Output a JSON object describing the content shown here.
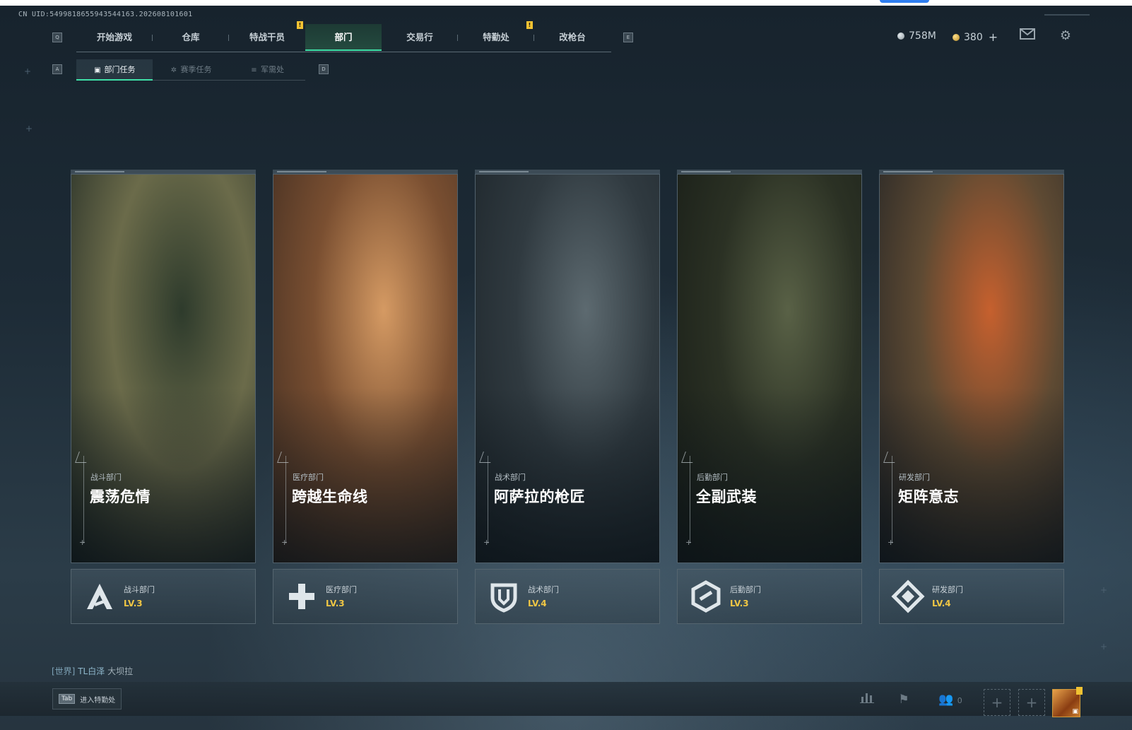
{
  "uid": "CN UID:5499818655943544163.202608101601",
  "keys": {
    "prev_tab": "Q",
    "next_tab": "E",
    "prev_sub": "A",
    "next_sub": "D"
  },
  "main_nav": {
    "tabs": [
      {
        "label": "开始游戏",
        "active": false
      },
      {
        "label": "仓库",
        "active": false
      },
      {
        "label": "特战干员",
        "active": false
      },
      {
        "label": "部门",
        "active": true
      },
      {
        "label": "交易行",
        "active": false
      },
      {
        "label": "特勤处",
        "active": false
      },
      {
        "label": "改枪台",
        "active": false
      }
    ]
  },
  "sub_nav": {
    "tabs": [
      {
        "label": "部门任务",
        "active": true,
        "icon": "task-icon"
      },
      {
        "label": "赛季任务",
        "active": false,
        "icon": "gear-icon"
      },
      {
        "label": "军需处",
        "active": false,
        "icon": "supply-icon"
      }
    ]
  },
  "currency": {
    "silver": "758M",
    "gold": "380",
    "add_label": "+"
  },
  "departments": [
    {
      "dept": "战斗部门",
      "title": "震荡危情",
      "level": "LV.3",
      "emblem": "combat-emblem-icon",
      "palette": [
        "#2e3b2c",
        "#6b6b4a",
        "#1c2622"
      ]
    },
    {
      "dept": "医疗部门",
      "title": "跨越生命线",
      "level": "LV.3",
      "emblem": "medical-emblem-icon",
      "palette": [
        "#d59a63",
        "#7a4f31",
        "#3b2a20"
      ]
    },
    {
      "dept": "战术部门",
      "title": "阿萨拉的枪匠",
      "level": "LV.4",
      "emblem": "tactical-emblem-icon",
      "palette": [
        "#5d6a70",
        "#303a40",
        "#1b2328"
      ]
    },
    {
      "dept": "后勤部门",
      "title": "全副武装",
      "level": "LV.3",
      "emblem": "logistics-emblem-icon",
      "palette": [
        "#596146",
        "#2b3124",
        "#161b16"
      ]
    },
    {
      "dept": "研发部门",
      "title": "矩阵意志",
      "level": "LV.4",
      "emblem": "rnd-emblem-icon",
      "palette": [
        "#c6602e",
        "#5e4a33",
        "#1e2124"
      ]
    }
  ],
  "chat": {
    "channel": "[世界]",
    "sender": "TL白泽",
    "message": "大坝拉"
  },
  "bottom": {
    "tab_key": "Tab",
    "tab_action": "进入特勤处",
    "friends_count": "0"
  },
  "colors": {
    "accent": "#3fe0a8",
    "level": "#f2c744",
    "notice": "#f1c232"
  }
}
